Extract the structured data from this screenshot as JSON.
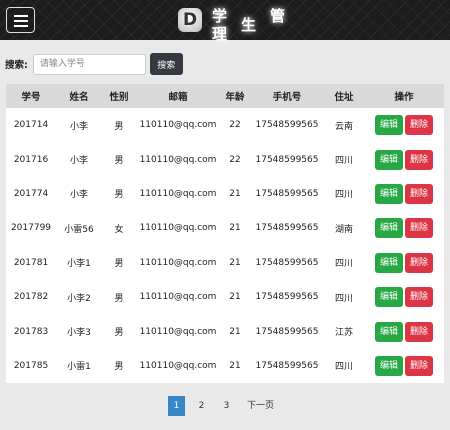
{
  "header": {
    "logo_letter": "D",
    "title_chars": [
      "学",
      "生",
      "管",
      "理"
    ]
  },
  "search": {
    "label": "搜索:",
    "placeholder": "请输入学号",
    "button": "搜索"
  },
  "table": {
    "columns": [
      "学号",
      "姓名",
      "性别",
      "邮箱",
      "年龄",
      "手机号",
      "住址",
      "操作"
    ],
    "rows": [
      {
        "id": "201714",
        "name": "小李",
        "gender": "男",
        "email": "110110@qq.com",
        "age": "22",
        "phone": "17548599565",
        "address": "云南"
      },
      {
        "id": "201716",
        "name": "小李",
        "gender": "男",
        "email": "110110@qq.com",
        "age": "22",
        "phone": "17548599565",
        "address": "四川"
      },
      {
        "id": "201774",
        "name": "小李",
        "gender": "男",
        "email": "110110@qq.com",
        "age": "21",
        "phone": "17548599565",
        "address": "四川"
      },
      {
        "id": "2017799",
        "name": "小雷56",
        "gender": "女",
        "email": "110110@qq.com",
        "age": "21",
        "phone": "17548599565",
        "address": "湖南"
      },
      {
        "id": "201781",
        "name": "小李1",
        "gender": "男",
        "email": "110110@qq.com",
        "age": "21",
        "phone": "17548599565",
        "address": "四川"
      },
      {
        "id": "201782",
        "name": "小李2",
        "gender": "男",
        "email": "110110@qq.com",
        "age": "21",
        "phone": "17548599565",
        "address": "四川"
      },
      {
        "id": "201783",
        "name": "小李3",
        "gender": "男",
        "email": "110110@qq.com",
        "age": "21",
        "phone": "17548599565",
        "address": "江苏"
      },
      {
        "id": "201785",
        "name": "小雷1",
        "gender": "男",
        "email": "110110@qq.com",
        "age": "21",
        "phone": "17548599565",
        "address": "四川"
      }
    ],
    "edit_label": "编辑",
    "delete_label": "删除"
  },
  "pagination": {
    "pages": [
      "1",
      "2",
      "3"
    ],
    "active": "1",
    "next_label": "下一页"
  },
  "colors": {
    "edit": "#28a745",
    "delete": "#dc3545",
    "active_page": "#3a87c8",
    "search_button": "#343a40"
  }
}
